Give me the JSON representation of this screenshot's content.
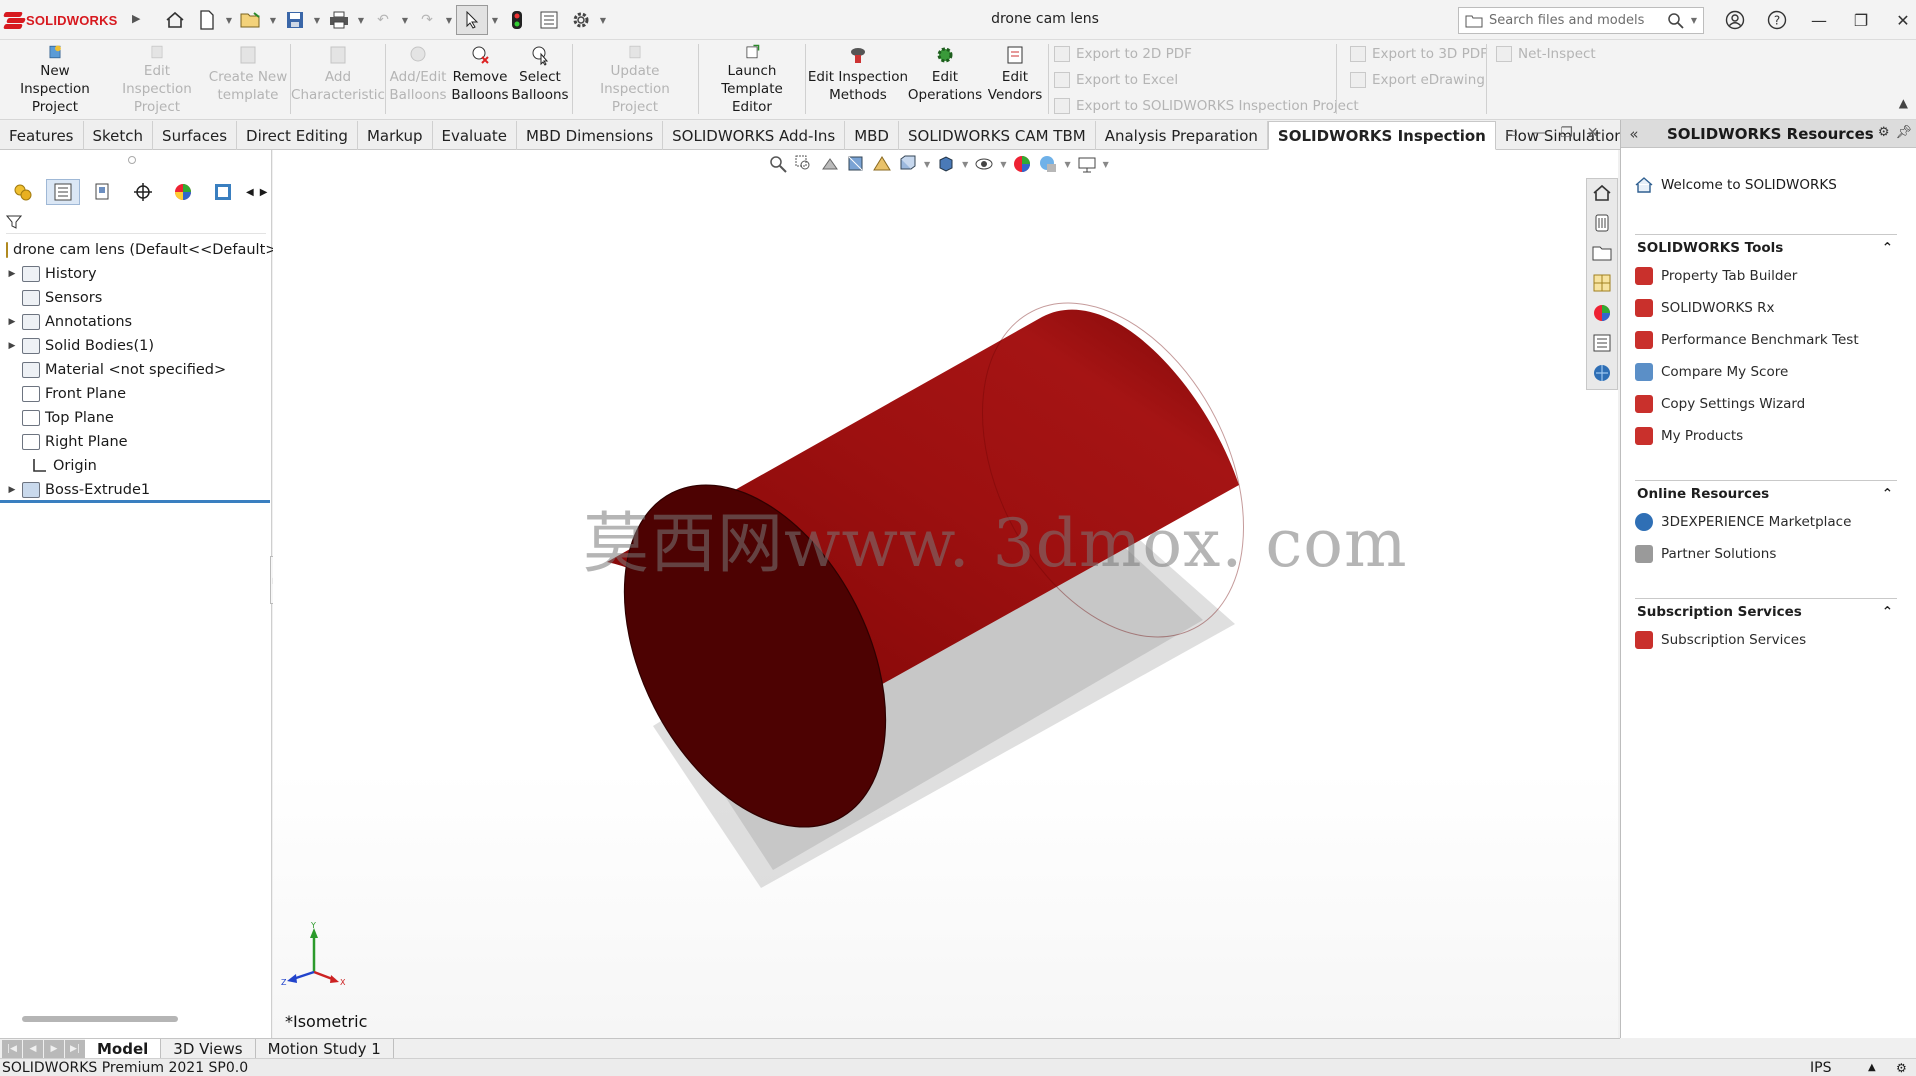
{
  "app": {
    "logo_text": "SOLIDWORKS",
    "doc_title": "drone cam lens",
    "search_placeholder": "Search files and models"
  },
  "ribbon": {
    "buttons": [
      {
        "label": "New Inspection Project",
        "line1": "New Inspection",
        "line2": "Project",
        "enabled": true
      },
      {
        "label": "Edit Inspection Project",
        "line1": "Edit Inspection",
        "line2": "Project",
        "enabled": false
      },
      {
        "label": "Create New template",
        "line1": "Create New",
        "line2": "template",
        "enabled": false
      },
      {
        "label": "Add Characteristic",
        "line1": "Add",
        "line2": "Characteristic",
        "enabled": false
      },
      {
        "label": "Add/Edit Balloons",
        "line1": "Add/Edit",
        "line2": "Balloons",
        "enabled": false
      },
      {
        "label": "Remove Balloons",
        "line1": "Remove",
        "line2": "Balloons",
        "enabled": true
      },
      {
        "label": "Select Balloons",
        "line1": "Select",
        "line2": "Balloons",
        "enabled": true
      },
      {
        "label": "Update Inspection Project",
        "line1": "Update Inspection",
        "line2": "Project",
        "enabled": false
      },
      {
        "label": "Launch Template Editor",
        "line1": "Launch",
        "line2": "Template Editor",
        "enabled": true
      },
      {
        "label": "Edit Inspection Methods",
        "line1": "Edit Inspection",
        "line2": "Methods",
        "enabled": true
      },
      {
        "label": "Edit Operations",
        "line1": "Edit",
        "line2": "Operations",
        "enabled": true
      },
      {
        "label": "Edit Vendors",
        "line1": "Edit",
        "line2": "Vendors",
        "enabled": true
      }
    ],
    "export_group_1": [
      "Export to 2D PDF",
      "Export to Excel",
      "Export to SOLIDWORKS Inspection Project"
    ],
    "export_group_2": [
      "Export to 3D PDF",
      "Export eDrawing"
    ],
    "net_inspect": "Net-Inspect"
  },
  "tabs": [
    "Features",
    "Sketch",
    "Surfaces",
    "Direct Editing",
    "Markup",
    "Evaluate",
    "MBD Dimensions",
    "SOLIDWORKS Add-Ins",
    "MBD",
    "SOLIDWORKS CAM TBM",
    "Analysis Preparation",
    "SOLIDWORKS Inspection",
    "Flow Simulation"
  ],
  "active_tab": "SOLIDWORKS Inspection",
  "feature_tree": {
    "root": "drone cam lens  (Default<<Default>",
    "items": [
      {
        "label": "History",
        "expandable": true
      },
      {
        "label": "Sensors",
        "expandable": false
      },
      {
        "label": "Annotations",
        "expandable": true
      },
      {
        "label": "Solid Bodies(1)",
        "expandable": true
      },
      {
        "label": "Material <not specified>",
        "expandable": false
      },
      {
        "label": "Front Plane",
        "expandable": false
      },
      {
        "label": "Top Plane",
        "expandable": false
      },
      {
        "label": "Right Plane",
        "expandable": false
      },
      {
        "label": "Origin",
        "expandable": false
      },
      {
        "label": "Boss-Extrude1",
        "expandable": true
      }
    ]
  },
  "viewport": {
    "view_label": "*Isometric",
    "watermark": "莫西网www. 3dmox. com",
    "triad": {
      "x": "X",
      "y": "Y",
      "z": "Z"
    },
    "model_color": "#8b0a0a",
    "model_dark": "#4a0000"
  },
  "taskpane": {
    "title": "SOLIDWORKS Resources",
    "welcome": "Welcome to SOLIDWORKS",
    "sections": [
      {
        "title": "SOLIDWORKS Tools",
        "items": [
          "Property Tab Builder",
          "SOLIDWORKS Rx",
          "Performance Benchmark Test",
          "Compare My Score",
          "Copy Settings Wizard",
          "My Products"
        ]
      },
      {
        "title": "Online Resources",
        "items": [
          "3DEXPERIENCE Marketplace",
          "Partner Solutions"
        ]
      },
      {
        "title": "Subscription Services",
        "items": [
          "Subscription Services"
        ]
      }
    ]
  },
  "bottom_tabs": [
    "Model",
    "3D Views",
    "Motion Study 1"
  ],
  "active_bottom_tab": "Model",
  "status": {
    "product": "SOLIDWORKS Premium 2021 SP0.0",
    "units": "IPS"
  },
  "colors": {
    "brand": "#d7191f",
    "accent": "#3a7fc0"
  }
}
